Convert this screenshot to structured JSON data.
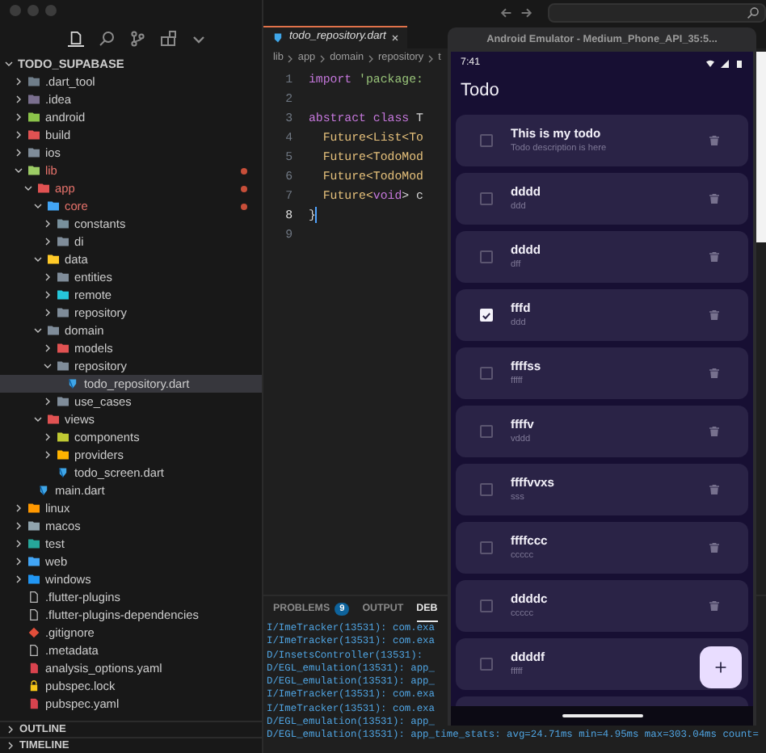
{
  "explorer": {
    "root": {
      "label": "TODO_SUPABASE",
      "expanded": true
    },
    "items": [
      {
        "label": ".dart_tool",
        "kind": "folder",
        "color": "#6f7d89",
        "expanded": false,
        "modified": false,
        "selected": false
      },
      {
        "label": ".idea",
        "kind": "folder",
        "color": "#7a6f8e",
        "expanded": false,
        "modified": false,
        "selected": false
      },
      {
        "label": "android",
        "kind": "folder",
        "color": "#8bc34a",
        "expanded": false,
        "modified": false,
        "selected": false
      },
      {
        "label": "build",
        "kind": "folder",
        "color": "#e05252",
        "expanded": false,
        "modified": false,
        "selected": false
      },
      {
        "label": "ios",
        "kind": "folder",
        "color": "#7f8c99",
        "expanded": false,
        "modified": false,
        "selected": false
      },
      {
        "label": "lib",
        "kind": "folder",
        "color": "#9ccc65",
        "expanded": true,
        "modified": true,
        "selected": false,
        "children": [
          {
            "label": "app",
            "kind": "folder",
            "color": "#e05252",
            "expanded": true,
            "modified": true,
            "selected": false,
            "children": [
              {
                "label": "core",
                "kind": "folder",
                "color": "#42a5f5",
                "expanded": true,
                "modified": true,
                "selected": false,
                "children": [
                  {
                    "label": "constants",
                    "kind": "folder",
                    "color": "#78909c",
                    "expanded": false,
                    "modified": false,
                    "selected": false
                  },
                  {
                    "label": "di",
                    "kind": "folder",
                    "color": "#7f8c99",
                    "expanded": false,
                    "modified": false,
                    "selected": false
                  }
                ]
              },
              {
                "label": "data",
                "kind": "folder",
                "color": "#ffca28",
                "expanded": true,
                "modified": false,
                "selected": false,
                "children": [
                  {
                    "label": "entities",
                    "kind": "folder",
                    "color": "#7f8c99",
                    "expanded": false,
                    "modified": false,
                    "selected": false
                  },
                  {
                    "label": "remote",
                    "kind": "folder",
                    "color": "#26c6da",
                    "expanded": false,
                    "modified": false,
                    "selected": false
                  },
                  {
                    "label": "repository",
                    "kind": "folder",
                    "color": "#7f8c99",
                    "expanded": false,
                    "modified": false,
                    "selected": false
                  }
                ]
              },
              {
                "label": "domain",
                "kind": "folder",
                "color": "#7f8c99",
                "expanded": true,
                "modified": false,
                "selected": false,
                "children": [
                  {
                    "label": "models",
                    "kind": "folder",
                    "color": "#e05252",
                    "expanded": false,
                    "modified": false,
                    "selected": false
                  },
                  {
                    "label": "repository",
                    "kind": "folder",
                    "color": "#7f8c99",
                    "expanded": true,
                    "modified": false,
                    "selected": false,
                    "children": [
                      {
                        "label": "todo_repository.dart",
                        "kind": "dart",
                        "modified": false,
                        "selected": true
                      }
                    ]
                  },
                  {
                    "label": "use_cases",
                    "kind": "folder",
                    "color": "#7f8c99",
                    "expanded": false,
                    "modified": false,
                    "selected": false
                  }
                ]
              },
              {
                "label": "views",
                "kind": "folder",
                "color": "#e05252",
                "expanded": true,
                "modified": false,
                "selected": false,
                "children": [
                  {
                    "label": "components",
                    "kind": "folder",
                    "color": "#c0ca33",
                    "expanded": false,
                    "modified": false,
                    "selected": false
                  },
                  {
                    "label": "providers",
                    "kind": "folder",
                    "color": "#ffb300",
                    "expanded": false,
                    "modified": false,
                    "selected": false
                  },
                  {
                    "label": "todo_screen.dart",
                    "kind": "dart",
                    "modified": false,
                    "selected": false
                  }
                ]
              }
            ]
          },
          {
            "label": "main.dart",
            "kind": "dart",
            "modified": false,
            "selected": false
          }
        ]
      },
      {
        "label": "linux",
        "kind": "folder",
        "color": "#ff9800",
        "expanded": false,
        "modified": false,
        "selected": false
      },
      {
        "label": "macos",
        "kind": "folder",
        "color": "#90a4ae",
        "expanded": false,
        "modified": false,
        "selected": false
      },
      {
        "label": "test",
        "kind": "folder",
        "color": "#26a69a",
        "expanded": false,
        "modified": false,
        "selected": false
      },
      {
        "label": "web",
        "kind": "folder",
        "color": "#42a5f5",
        "expanded": false,
        "modified": false,
        "selected": false
      },
      {
        "label": "windows",
        "kind": "folder",
        "color": "#2196f3",
        "expanded": false,
        "modified": false,
        "selected": false
      },
      {
        "label": ".flutter-plugins",
        "kind": "file",
        "modified": false,
        "selected": false
      },
      {
        "label": ".flutter-plugins-dependencies",
        "kind": "file",
        "modified": false,
        "selected": false
      },
      {
        "label": ".gitignore",
        "kind": "git",
        "modified": false,
        "selected": false
      },
      {
        "label": ".metadata",
        "kind": "file",
        "modified": false,
        "selected": false
      },
      {
        "label": "analysis_options.yaml",
        "kind": "yaml",
        "modified": false,
        "selected": false
      },
      {
        "label": "pubspec.lock",
        "kind": "lock",
        "modified": false,
        "selected": false
      },
      {
        "label": "pubspec.yaml",
        "kind": "yaml",
        "modified": false,
        "selected": false
      }
    ],
    "sections": [
      {
        "label": "OUTLINE",
        "expanded": false
      },
      {
        "label": "TIMELINE",
        "expanded": false
      }
    ]
  },
  "editor": {
    "tabs": [
      {
        "label": "todo_repository.dart",
        "selected": true
      }
    ],
    "breadcrumb": [
      "lib",
      "app",
      "domain",
      "repository",
      "t"
    ],
    "lines": [
      {
        "number": "1",
        "active": false,
        "tokens": [
          {
            "kind": "keyword",
            "text": "import"
          },
          {
            "kind": "string",
            "text": " 'package:"
          }
        ]
      },
      {
        "number": "2",
        "active": false
      },
      {
        "number": "3",
        "active": false,
        "tokens": [
          {
            "kind": "keyword",
            "text": "abstract class"
          },
          {
            "kind": "plain",
            "text": " T"
          }
        ]
      },
      {
        "number": "4",
        "active": false,
        "tokens": [
          {
            "kind": "type",
            "text": "  Future<List<To"
          }
        ]
      },
      {
        "number": "5",
        "active": false,
        "tokens": [
          {
            "kind": "type",
            "text": "  Future<TodoMod"
          }
        ]
      },
      {
        "number": "6",
        "active": false,
        "tokens": [
          {
            "kind": "type",
            "text": "  Future<TodoMod"
          }
        ]
      },
      {
        "number": "7",
        "active": false,
        "tokens": [
          {
            "kind": "type",
            "text": "  Future<"
          },
          {
            "kind": "keyword",
            "text": "void"
          },
          {
            "kind": "plain",
            "text": "> c"
          }
        ]
      },
      {
        "number": "8",
        "active": true,
        "tokens": [
          {
            "kind": "plain",
            "text": "}"
          }
        ]
      },
      {
        "number": "9",
        "active": false
      }
    ]
  },
  "panel": {
    "tabs": [
      {
        "label": "PROBLEMS",
        "badge": "9",
        "selected": false
      },
      {
        "label": "OUTPUT",
        "selected": false
      },
      {
        "label": "DEB",
        "selected": true
      }
    ],
    "lines": [
      "I/ImeTracker(13531): com.exa",
      "I/ImeTracker(13531): com.exa",
      "D/InsetsController(13531): ",
      "D/EGL_emulation(13531): app_",
      "D/EGL_emulation(13531): app_",
      "I/ImeTracker(13531): com.exa",
      "I/ImeTracker(13531): com.exa",
      "D/EGL_emulation(13531): app_",
      "D/EGL_emulation(13531): app_time_stats: avg=24.71ms min=4.95ms max=303.04ms count="
    ]
  },
  "emulator": {
    "title": "Android Emulator - Medium_Phone_API_35:5...",
    "time": "7:41",
    "app_title": "Todo",
    "todos": [
      {
        "title": "This is my todo",
        "description": "Todo description is here",
        "checked": false
      },
      {
        "title": "dddd",
        "description": "ddd",
        "checked": false
      },
      {
        "title": "dddd",
        "description": "dff",
        "checked": false
      },
      {
        "title": "fffd",
        "description": "ddd",
        "checked": true
      },
      {
        "title": "ffffss",
        "description": "fffff",
        "checked": false
      },
      {
        "title": "ffffv",
        "description": "vddd",
        "checked": false
      },
      {
        "title": "ffffvvxs",
        "description": "sss",
        "checked": false
      },
      {
        "title": "ffffccc",
        "description": "ccccc",
        "checked": false
      },
      {
        "title": "ddddc",
        "description": "ccccc",
        "checked": false
      },
      {
        "title": "ddddf",
        "description": "fffff",
        "checked": false
      }
    ]
  }
}
